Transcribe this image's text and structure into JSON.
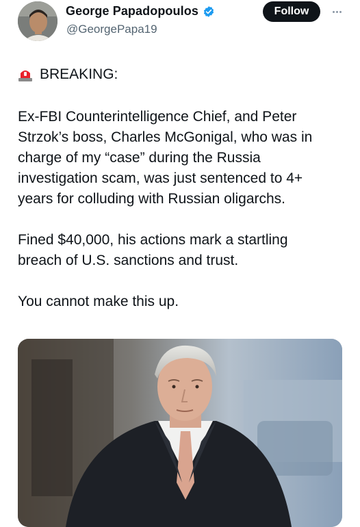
{
  "author": {
    "display_name": "George Papadopoulos",
    "handle": "@GeorgePapa19",
    "verified": true,
    "verified_color": "#1d9bf0"
  },
  "actions": {
    "follow_label": "Follow",
    "more_icon": "more-horizontal-icon"
  },
  "tweet": {
    "breaking_emoji": "siren-icon",
    "breaking_label": "BREAKING:",
    "paragraphs": [
      "Ex-FBI Counterintelligence Chief, and Peter\nStrzok’s boss, Charles McGonigal, who was in\ncharge of my “case” during the Russia\ninvestigation scam, was just sentenced to 4+\nyears for colluding with Russian oligarchs.",
      "Fined $40,000, his actions mark a startling\nbreach of U.S. sanctions and trust.",
      "You cannot make this up."
    ]
  },
  "colors": {
    "text": "#0f1419",
    "secondary": "#536471",
    "follow_bg": "#0f1419",
    "follow_text": "#ffffff"
  }
}
